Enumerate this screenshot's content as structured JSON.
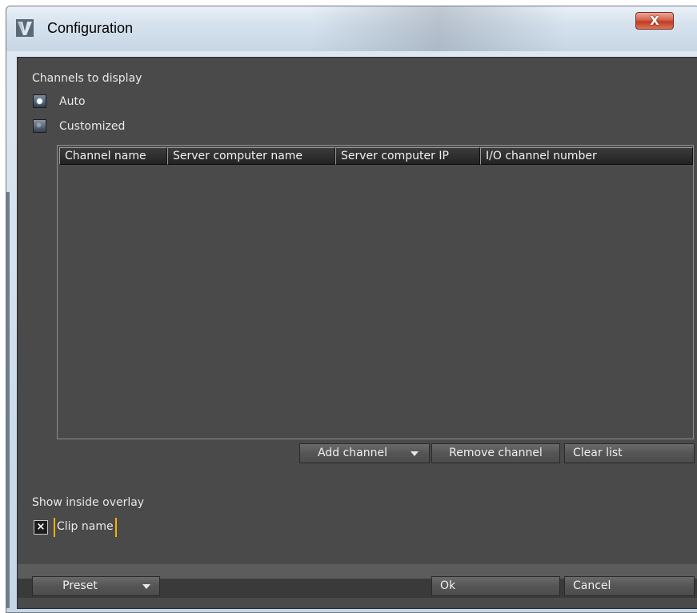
{
  "window": {
    "title": "Configuration",
    "close_label": "X"
  },
  "channels": {
    "section_label": "Channels to display",
    "options": [
      {
        "label": "Auto",
        "selected": true
      },
      {
        "label": "Customized",
        "selected": false
      }
    ],
    "columns": [
      "Channel name",
      "Server computer name",
      "Server computer IP",
      "I/O channel number"
    ],
    "rows": []
  },
  "channel_buttons": {
    "add": "Add channel",
    "remove": "Remove channel",
    "clear": "Clear list"
  },
  "overlay": {
    "section_label": "Show inside overlay",
    "checkbox_mark": "×",
    "clip_name_label": "Clip name",
    "clip_name_checked": true
  },
  "footer": {
    "preset": "Preset",
    "ok": "Ok",
    "cancel": "Cancel"
  },
  "colors": {
    "panel_bg": "#4a4a4a",
    "edit_highlight": "#f2b300",
    "close_button": "#c23b22"
  }
}
